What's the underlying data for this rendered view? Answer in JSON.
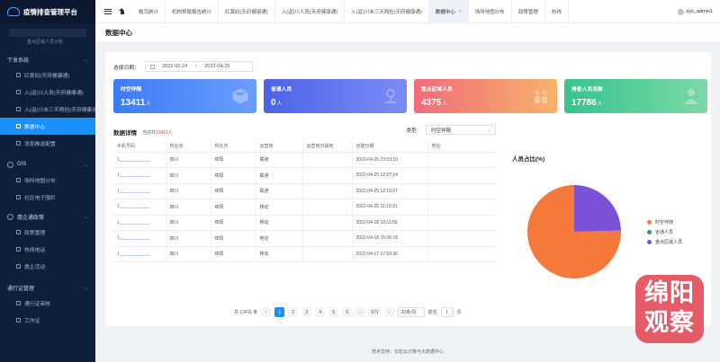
{
  "app": {
    "title": "疫情排查管理平台"
  },
  "sidebar": {
    "cut_item": "重点区域人员分析",
    "groups": [
      {
        "label": "下发系统",
        "items": [
          "红黄码(天府健康通)",
          "入(返)川人员(天府健康通)",
          "入(返)川未三天两检(天府健康通)",
          "数据中心",
          "消息推送配置"
        ]
      },
      {
        "label": "GIS",
        "items": [
          "场所地图分布",
          "社区电子围栏"
        ]
      },
      {
        "label": "惠企通政策",
        "items": [
          "政策管理",
          "热线电话",
          "惠企活动"
        ]
      },
      {
        "label": "通行证管理",
        "items": [
          "通行证审核",
          "工作证"
        ]
      }
    ],
    "active_item": "数据中心"
  },
  "topbar": {
    "tabs": [
      "概况统计",
      "机构移服报告统计",
      "红黄码(天府健康通)",
      "入(返)川人员(天府健康通)",
      "入(返)川未三天两检(天府健康通)",
      "数据中心",
      "场所地图分布",
      "政策管理",
      "热线"
    ],
    "active_tab": "数据中心",
    "close_glyph": "×",
    "user": "sys_admin1"
  },
  "page": {
    "title": "数据中心",
    "date_label": "选择日期：",
    "date_start": "2022-02-24",
    "date_sep": "~",
    "date_end": "2022-04-25"
  },
  "stats": [
    {
      "title": "时空伴随",
      "value": "13411",
      "unit": "人",
      "icon": "cube-icon"
    },
    {
      "title": "省通人员",
      "value": "0",
      "unit": "人",
      "icon": "location-person-icon"
    },
    {
      "title": "重点区域人员",
      "value": "4375",
      "unit": "人",
      "icon": "group-icon"
    },
    {
      "title": "排查人员总数",
      "value": "17786",
      "unit": "人",
      "icon": "person-icon"
    }
  ],
  "detail": {
    "title": "数据详情",
    "count_prefix": "当前共",
    "count_value": "13411",
    "count_suffix": "人",
    "type_label": "类型：",
    "type_value": "时空伴随",
    "columns": [
      "手机号码",
      "所在省",
      "所在市",
      "运营商",
      "运营商归属地",
      "创建日期",
      "地址"
    ],
    "rows": [
      [
        "1____________",
        "四川",
        "绵阳",
        "联通",
        "",
        "2022-04-25 23:53:10",
        ""
      ],
      [
        "1____________",
        "四川",
        "绵阳",
        "联通",
        "",
        "2022-04-25 12:27:14",
        ""
      ],
      [
        "1____________",
        "四川",
        "绵阳",
        "联通",
        "",
        "2022-04-25 12:16:07",
        ""
      ],
      [
        "1____________",
        "四川",
        "绵阳",
        "移动",
        "",
        "2022-04-25 11:19:31",
        ""
      ],
      [
        "1____________",
        "四川",
        "绵阳",
        "移动",
        "",
        "2022-04-18 19:11:59",
        ""
      ],
      [
        "1____________",
        "四川",
        "绵阳",
        "电信",
        "",
        "2022-04-18 15:06:18",
        ""
      ],
      [
        "1____________",
        "四川",
        "绵阳",
        "移动",
        "",
        "2022-04-17 17:59:36",
        ""
      ]
    ]
  },
  "pager": {
    "total": "共 13411 条",
    "prev": "‹",
    "pages": [
      "1",
      "2",
      "3",
      "4",
      "5",
      "6",
      "···",
      "671"
    ],
    "active": "1",
    "next": "›",
    "size": "20条/页",
    "goto_label": "前往",
    "goto_value": "1",
    "goto_suffix": "页"
  },
  "pie": {
    "title": "人员占比(%)"
  },
  "chart_data": {
    "type": "pie",
    "title": "人员占比(%)",
    "categories": [
      "时空伴随",
      "省通人员",
      "重点区域人员"
    ],
    "values": [
      13411,
      0,
      4375
    ],
    "colors": [
      "#f5793a",
      "#2e9e63",
      "#7b52d6"
    ],
    "legend": "right"
  },
  "footer": {
    "text": "技术支持：长虹云计算与大数据中心"
  },
  "watermark": {
    "text": "绵阳观察"
  }
}
